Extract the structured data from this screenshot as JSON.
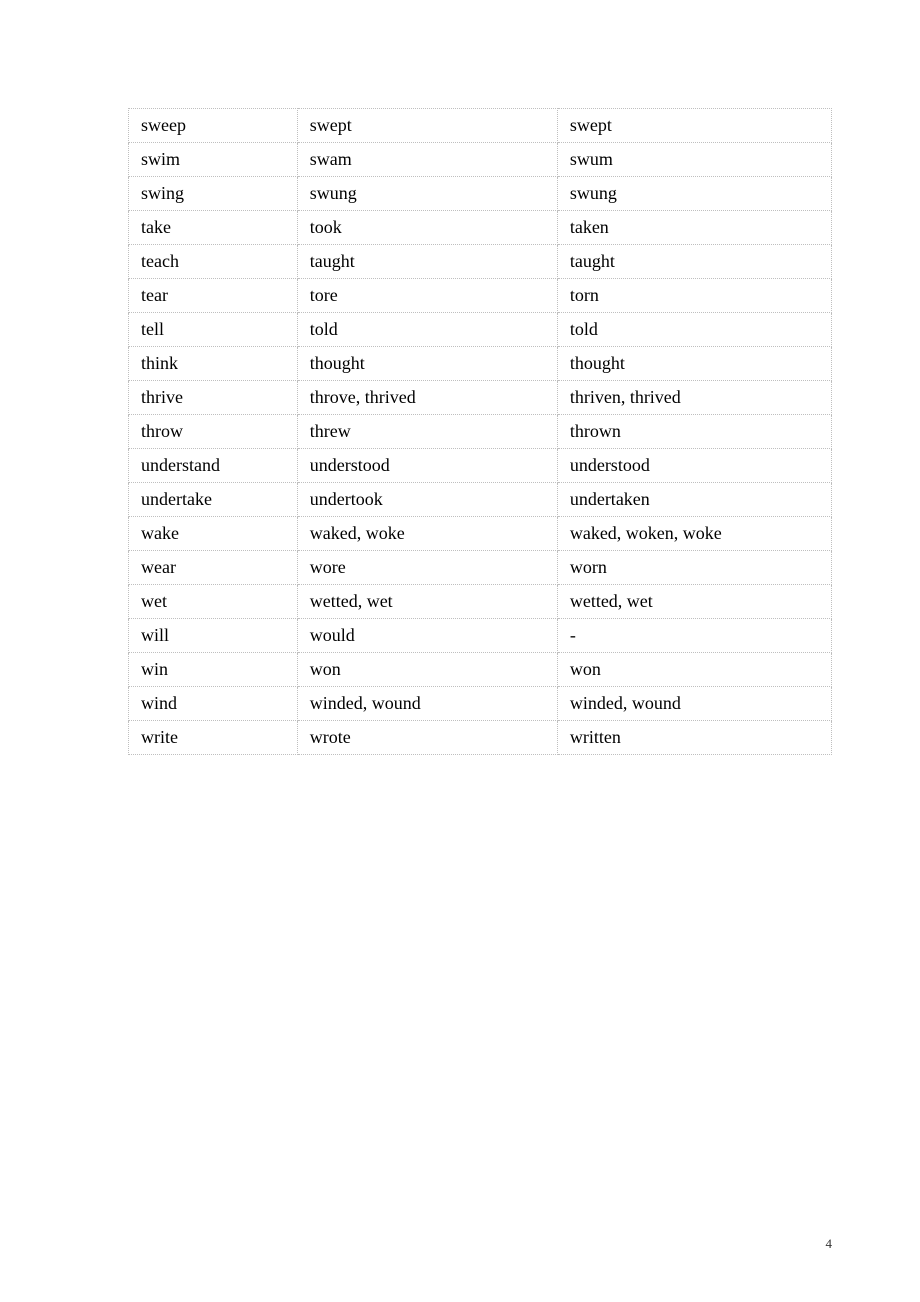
{
  "rows": [
    {
      "c1": "sweep",
      "c2": "swept",
      "c3": "swept"
    },
    {
      "c1": "swim",
      "c2": "swam",
      "c3": "swum"
    },
    {
      "c1": "swing",
      "c2": "swung",
      "c3": "swung"
    },
    {
      "c1": "take",
      "c2": "took",
      "c3": "taken"
    },
    {
      "c1": "teach",
      "c2": "taught",
      "c3": "taught"
    },
    {
      "c1": "tear",
      "c2": "tore",
      "c3": "torn"
    },
    {
      "c1": "tell",
      "c2": "told",
      "c3": "told"
    },
    {
      "c1": "think",
      "c2": "thought",
      "c3": "thought"
    },
    {
      "c1": "thrive",
      "c2": "throve, thrived",
      "c3": "thriven, thrived"
    },
    {
      "c1": "throw",
      "c2": "threw",
      "c3": "thrown"
    },
    {
      "c1": "understand",
      "c2": "understood",
      "c3": "understood"
    },
    {
      "c1": "undertake",
      "c2": "undertook",
      "c3": "undertaken"
    },
    {
      "c1": "wake",
      "c2": "waked, woke",
      "c3": "waked, woken, woke"
    },
    {
      "c1": "wear",
      "c2": "wore",
      "c3": "worn"
    },
    {
      "c1": "wet",
      "c2": "wetted, wet",
      "c3": "wetted, wet"
    },
    {
      "c1": "will",
      "c2": "would",
      "c3": "-"
    },
    {
      "c1": "win",
      "c2": "won",
      "c3": "won"
    },
    {
      "c1": "wind",
      "c2": "winded, wound",
      "c3": "winded, wound"
    },
    {
      "c1": "write",
      "c2": "wrote",
      "c3": "written"
    }
  ],
  "page_number": "4"
}
